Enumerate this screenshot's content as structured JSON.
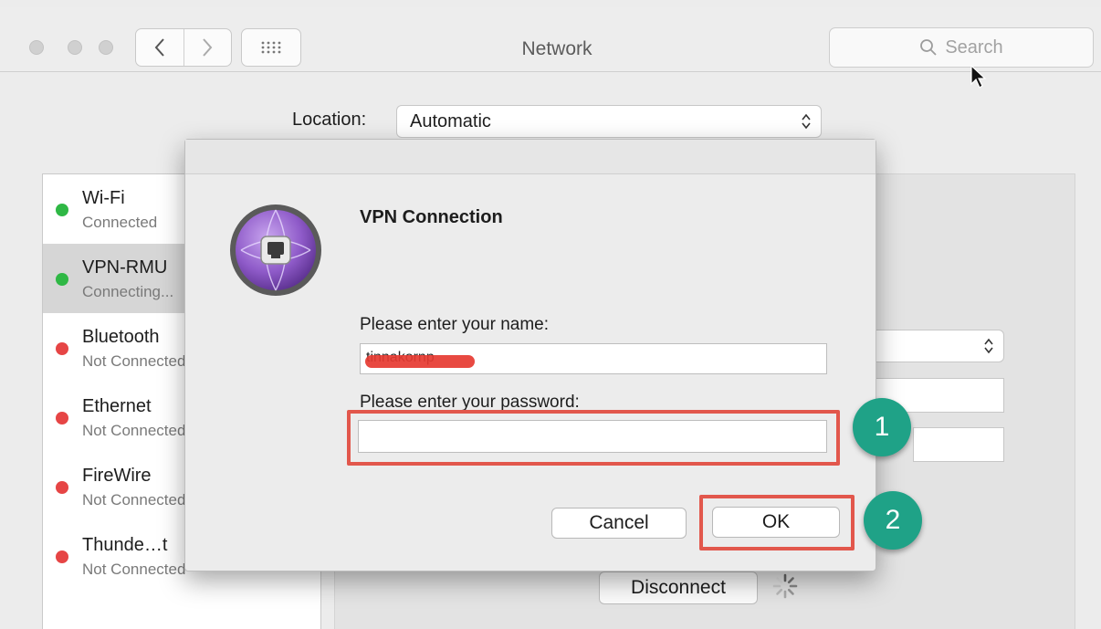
{
  "window": {
    "title": "Network",
    "search_placeholder": "Search"
  },
  "location": {
    "label": "Location:",
    "value": "Automatic"
  },
  "services": [
    {
      "name": "Wi-Fi",
      "status": "Connected",
      "state_color": "#2fb845"
    },
    {
      "name": "VPN-RMU",
      "status": "Connecting...",
      "state_color": "#2fb845"
    },
    {
      "name": "Bluetooth",
      "status": "Not Connected",
      "state_color": "#e64545"
    },
    {
      "name": "Ethernet",
      "status": "Not Connected",
      "state_color": "#e64545"
    },
    {
      "name": "FireWire",
      "status": "Not Connected",
      "state_color": "#e64545"
    },
    {
      "name": "Thunde…t",
      "status": "Not Connected",
      "state_color": "#e64545"
    }
  ],
  "detail": {
    "disconnect_label": "Disconnect"
  },
  "dialog": {
    "title": "VPN Connection",
    "name_prompt": "Please enter your name:",
    "name_value": "tinnakornp",
    "password_prompt": "Please enter your password:",
    "password_value": "",
    "cancel_label": "Cancel",
    "ok_label": "OK"
  },
  "annotations": {
    "step1": "1",
    "step2": "2",
    "highlight_color": "#e2574c",
    "badge_color": "#1fa287"
  },
  "icons": [
    "back-chevron-icon",
    "forward-chevron-icon",
    "grid-icon",
    "search-icon",
    "mouse-cursor-icon",
    "vpn-globe-icon",
    "spinner-icon",
    "updown-arrows-icon"
  ]
}
